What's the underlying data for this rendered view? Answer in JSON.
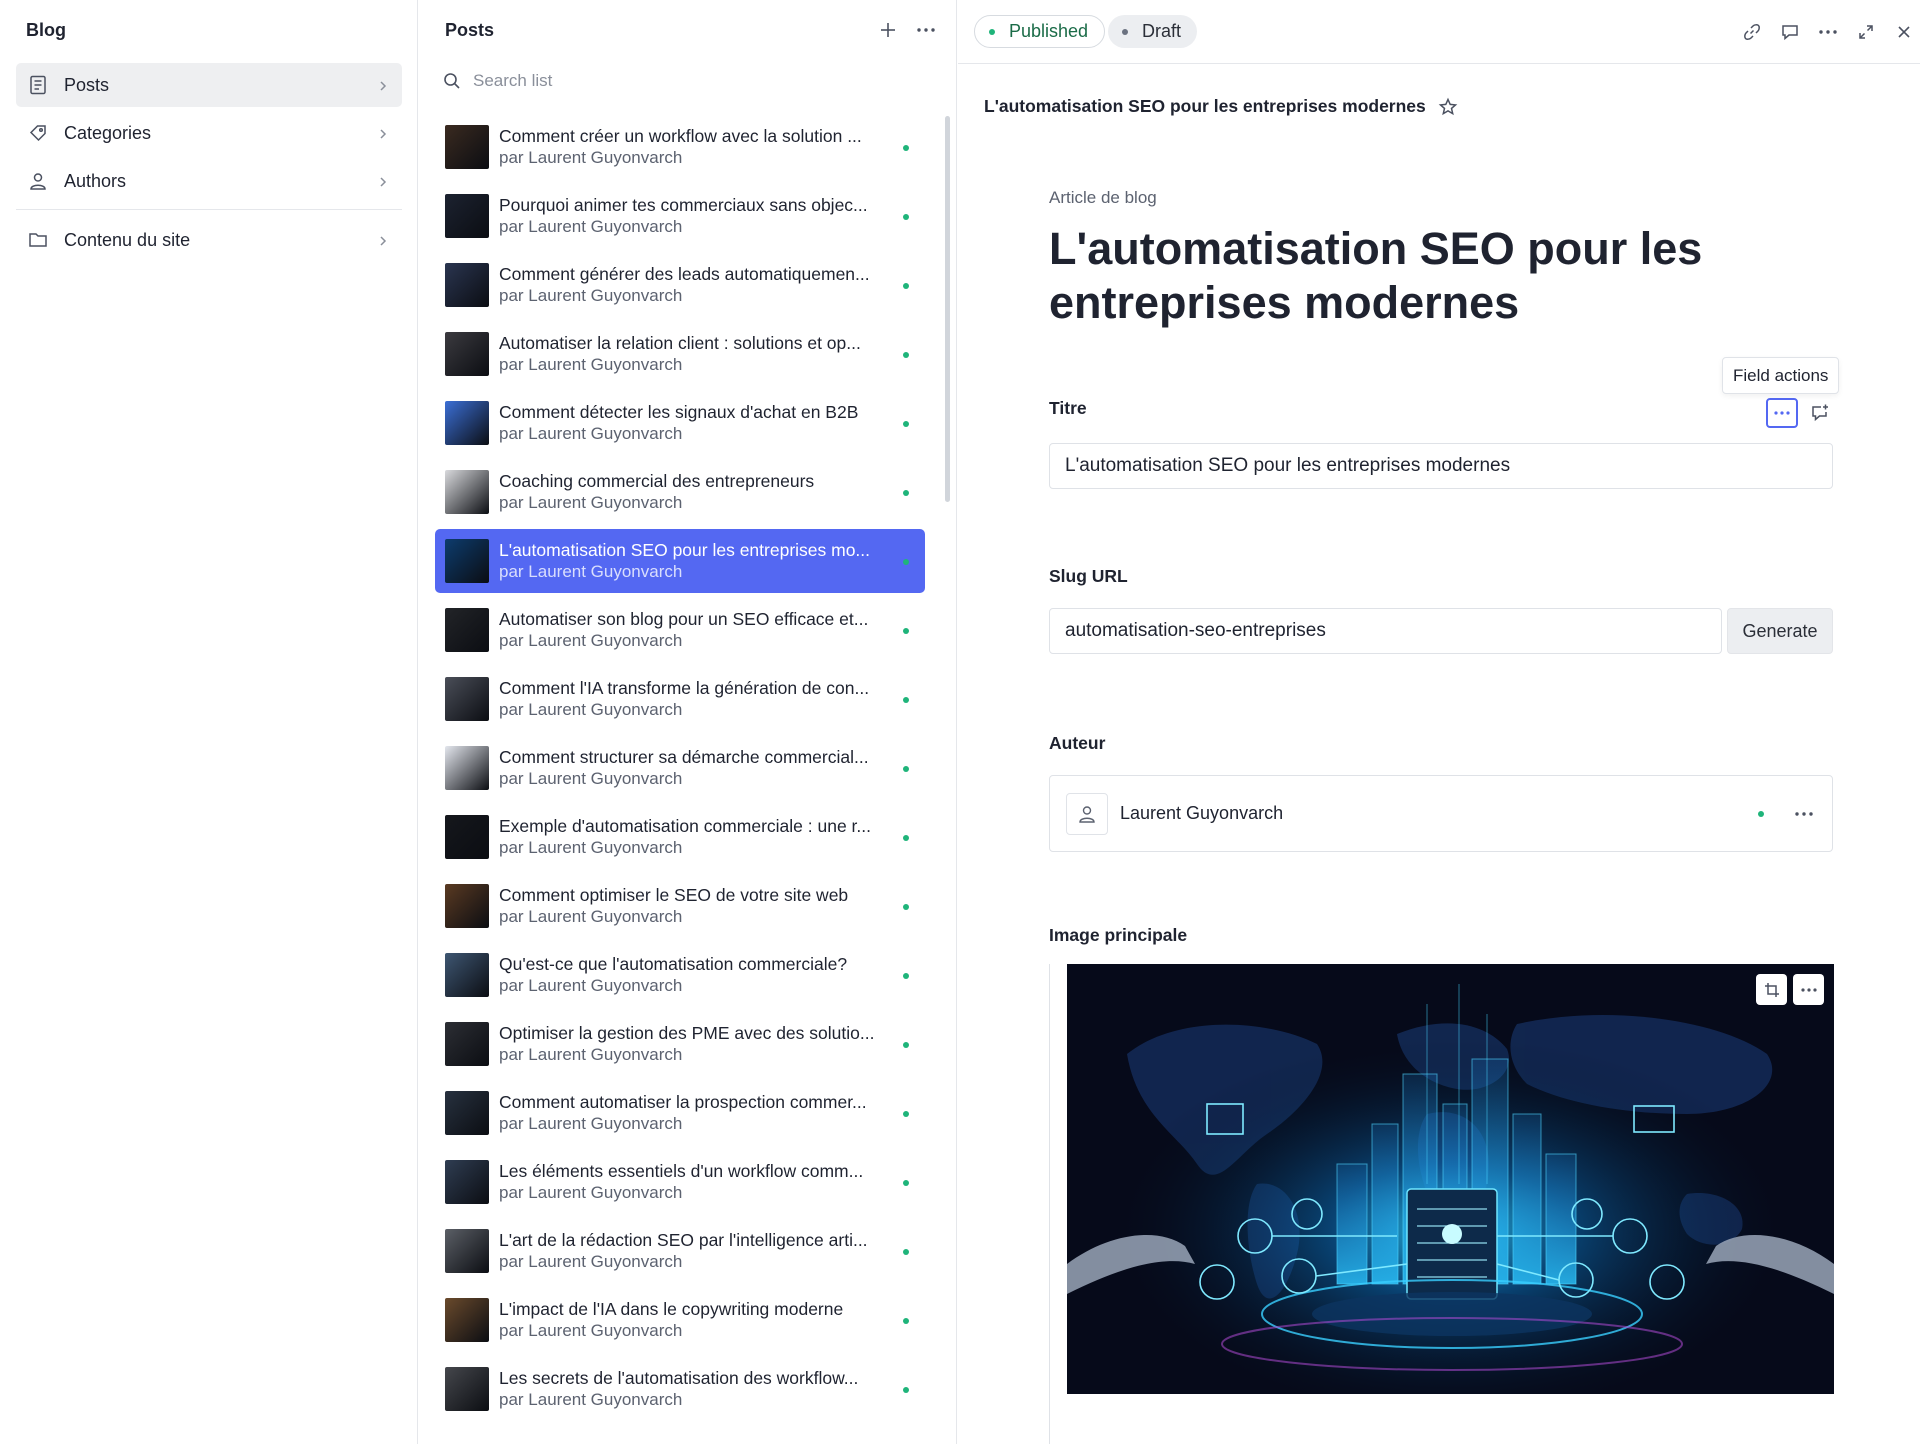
{
  "nav": {
    "title": "Blog",
    "items": [
      {
        "label": "Posts",
        "icon": "document-icon",
        "active": true
      },
      {
        "label": "Categories",
        "icon": "tag-icon",
        "active": false
      },
      {
        "label": "Authors",
        "icon": "user-icon",
        "active": false
      },
      {
        "label": "Contenu du site",
        "icon": "folder-icon",
        "active": false
      }
    ]
  },
  "posts": {
    "title": "Posts",
    "search_placeholder": "Search list",
    "items": [
      {
        "title": "Comment créer un workflow avec la solution ...",
        "author": "par Laurent Guyonvarch",
        "thumb": "#3a2a20"
      },
      {
        "title": "Pourquoi animer tes commerciaux sans objec...",
        "author": "par Laurent Guyonvarch",
        "thumb": "#1c2230"
      },
      {
        "title": "Comment générer des leads automatiquemen...",
        "author": "par Laurent Guyonvarch",
        "thumb": "#2a3550"
      },
      {
        "title": "Automatiser la relation client : solutions et op...",
        "author": "par Laurent Guyonvarch",
        "thumb": "#3b3a3f"
      },
      {
        "title": "Comment détecter les signaux d'achat en B2B",
        "author": "par Laurent Guyonvarch",
        "thumb": "#3b6fd6"
      },
      {
        "title": "Coaching commercial des entrepreneurs",
        "author": "par Laurent Guyonvarch",
        "thumb": "#d9dadd"
      },
      {
        "title": "L'automatisation SEO pour les entreprises mo...",
        "author": "par Laurent Guyonvarch",
        "thumb": "#0d3c6e",
        "active": true
      },
      {
        "title": "Automatiser son blog pour un SEO efficace et...",
        "author": "par Laurent Guyonvarch",
        "thumb": "#222428"
      },
      {
        "title": "Comment l'IA transforme la génération de con...",
        "author": "par Laurent Guyonvarch",
        "thumb": "#4a4e58"
      },
      {
        "title": "Comment structurer sa démarche commercial...",
        "author": "par Laurent Guyonvarch",
        "thumb": "#e4e7ee"
      },
      {
        "title": "Exemple d'automatisation commerciale : une r...",
        "author": "par Laurent Guyonvarch",
        "thumb": "#15171c"
      },
      {
        "title": "Comment optimiser le SEO de votre site web",
        "author": "par Laurent Guyonvarch",
        "thumb": "#5a3a22"
      },
      {
        "title": "Qu'est-ce que l'automatisation commerciale?",
        "author": "par Laurent Guyonvarch",
        "thumb": "#3e5672"
      },
      {
        "title": "Optimiser la gestion des PME avec des solutio...",
        "author": "par Laurent Guyonvarch",
        "thumb": "#2c2e34"
      },
      {
        "title": "Comment automatiser la prospection commer...",
        "author": "par Laurent Guyonvarch",
        "thumb": "#27313f"
      },
      {
        "title": "Les éléments essentiels d'un workflow comm...",
        "author": "par Laurent Guyonvarch",
        "thumb": "#2f3d52"
      },
      {
        "title": "L'art de la rédaction SEO par l'intelligence arti...",
        "author": "par Laurent Guyonvarch",
        "thumb": "#5b5f66"
      },
      {
        "title": "L'impact de l'IA dans le copywriting moderne",
        "author": "par Laurent Guyonvarch",
        "thumb": "#6a4a2c"
      },
      {
        "title": "Les secrets de l'automatisation des workflow...",
        "author": "par Laurent Guyonvarch",
        "thumb": "#45474c"
      }
    ]
  },
  "editor": {
    "status": {
      "published": "Published",
      "draft": "Draft"
    },
    "doc_heading": "L'automatisation SEO pour les entreprises modernes",
    "doc_type": "Article de blog",
    "big_title": "L'automatisation SEO pour les entreprises modernes",
    "tooltip": "Field actions",
    "fields": {
      "title_label": "Titre",
      "title_value": "L'automatisation SEO pour les entreprises modernes",
      "slug_label": "Slug URL",
      "slug_value": "automatisation-seo-entreprises",
      "generate_label": "Generate",
      "author_label": "Auteur",
      "author_value": "Laurent Guyonvarch",
      "image_label": "Image principale"
    }
  },
  "colors": {
    "accent": "#5468f2",
    "published_dot": "#1fb47a"
  }
}
